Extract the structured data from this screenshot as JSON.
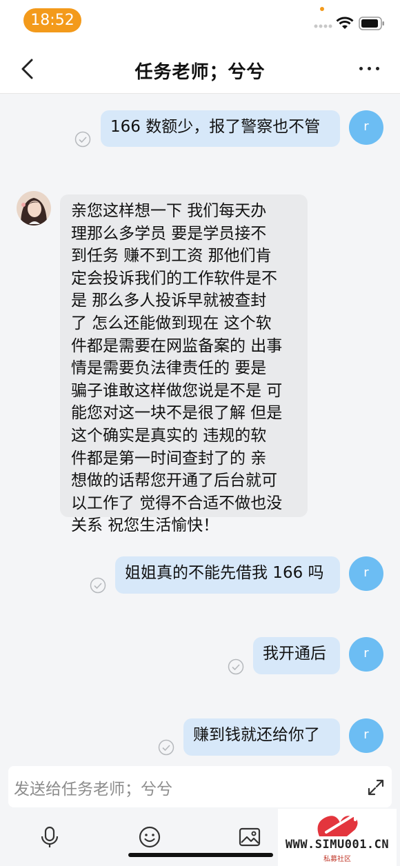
{
  "status_bar": {
    "time": "18:52"
  },
  "header": {
    "title": "任务老师；兮兮"
  },
  "messages": [
    {
      "side": "right",
      "text": "166 数额少，报了警察也不管",
      "avatar": "r"
    },
    {
      "side": "left",
      "text": "亲您这样想一下 我们每天办理那么多学员 要是学员接不到任务 赚不到工资 那他们肯定会投诉我们的工作软件是不是 那么多人投诉早就被查封了 怎么还能做到现在 这个软件都是需要在网监备案的 出事情是需要负法律责任的 要是骗子谁敢这样做您说是不是 可能您对这一块不是很了解 但是这个确实是真实的 违规的软件都是第一时间查封了的 亲想做的话帮您开通了后台就可以工作了 觉得不合适不做也没关系 祝您生活愉快！"
    },
    {
      "side": "right",
      "text": "姐姐真的不能先借我 166 吗",
      "avatar": "r"
    },
    {
      "side": "right",
      "text": "我开通后",
      "avatar": "r"
    },
    {
      "side": "right",
      "text": "赚到钱就还给你了",
      "avatar": "r"
    }
  ],
  "left_message_lines": [
    "亲您这样想一下  我们每天办",
    "理那么多学员   要是学员接不",
    "到任务 赚不到工资  那他们肯",
    "定会投诉我们的工作软件是不",
    "是  那么多人投诉早就被查封",
    "了 怎么还能做到现在   这个软",
    "件都是需要在网监备案的 出事",
    "情是需要负法律责任的  要是",
    "骗子谁敢这样做您说是不是 可",
    "能您对这一块不是很了解 但是",
    "这个确实是真实的  违规的软",
    "件都是第一时间查封了的   亲",
    "想做的话帮您开通了后台就可",
    "以工作了 觉得不合适不做也没",
    "关系 祝您生活愉快！"
  ],
  "input": {
    "placeholder": "发送给任务老师；兮兮"
  },
  "watermark": {
    "url": "WWW.SIMU001.CN",
    "sub": "私募社区"
  },
  "colors": {
    "accent": "#f39a1b",
    "my_bubble": "#d7e8f9",
    "their_bubble": "#e9eaec",
    "avatar": "#6cbdf3"
  },
  "icons": [
    "back-icon",
    "more-icon",
    "read-check-icon",
    "microphone-icon",
    "emoji-icon",
    "image-icon",
    "expand-icon"
  ]
}
